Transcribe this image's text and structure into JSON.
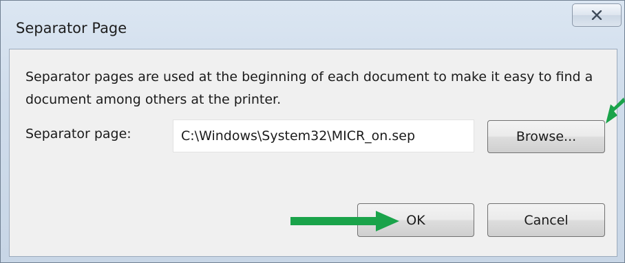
{
  "window": {
    "title": "Separator Page",
    "close_icon": "close-icon"
  },
  "body": {
    "description": "Separator pages are used at the beginning of each document to make it easy to find a document among others at the printer.",
    "separator_label": "Separator page:",
    "separator_value": "C:\\Windows\\System32\\MICR_on.sep"
  },
  "buttons": {
    "browse": "Browse...",
    "ok": "OK",
    "cancel": "Cancel"
  },
  "annotations": {
    "arrow_color": "#1aa34a",
    "arrows": [
      "arrow-to-ok",
      "arrow-to-browse"
    ]
  }
}
